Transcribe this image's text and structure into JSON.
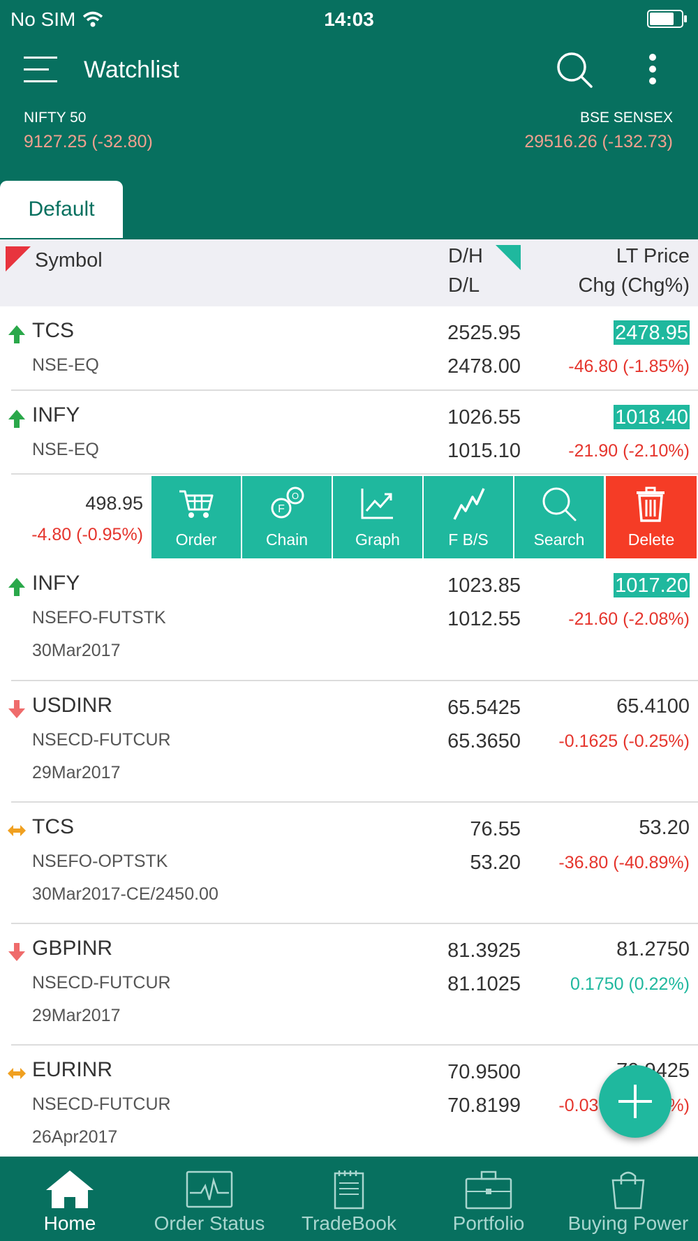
{
  "status": {
    "carrier": "No SIM",
    "time": "14:03"
  },
  "appbar": {
    "title": "Watchlist"
  },
  "indices": {
    "left": {
      "name": "NIFTY 50",
      "value": "9127.25 (-32.80)"
    },
    "right": {
      "name": "BSE SENSEX",
      "value": "29516.26 (-132.73)"
    }
  },
  "tabs": {
    "active": "Default"
  },
  "columns": {
    "symbol": "Symbol",
    "dh": "D/H",
    "dl": "D/L",
    "lt": "LT Price",
    "chg": "Chg (Chg%)"
  },
  "rows": [
    {
      "symbol": "TCS",
      "exchange": "NSE-EQ",
      "expiry": "",
      "dh": "2525.95",
      "dl": "2478.00",
      "lt": "2478.95",
      "chg": "-46.80 (-1.85%)",
      "trend": "up"
    },
    {
      "symbol": "INFY",
      "exchange": "NSE-EQ",
      "expiry": "",
      "dh": "1026.55",
      "dl": "1015.10",
      "lt": "1018.40",
      "chg": "-21.90 (-2.10%)",
      "trend": "up"
    },
    {
      "symbol": "INFY",
      "exchange": "NSEFO-FUTSTK",
      "expiry": "30Mar2017",
      "dh": "1023.85",
      "dl": "1012.55",
      "lt": "1017.20",
      "chg": "-21.60 (-2.08%)",
      "trend": "up"
    },
    {
      "symbol": "USDINR",
      "exchange": "NSECD-FUTCUR",
      "expiry": "29Mar2017",
      "dh": "65.5425",
      "dl": "65.3650",
      "lt": "65.4100",
      "chg": "-0.1625 (-0.25%)",
      "trend": "down"
    },
    {
      "symbol": "TCS",
      "exchange": "NSEFO-OPTSTK",
      "expiry": "30Mar2017-CE/2450.00",
      "dh": "76.55",
      "dl": "53.20",
      "lt": "53.20",
      "chg": "-36.80 (-40.89%)",
      "trend": "flat"
    },
    {
      "symbol": "GBPINR",
      "exchange": "NSECD-FUTCUR",
      "expiry": "29Mar2017",
      "dh": "81.3925",
      "dl": "81.1025",
      "lt": "81.2750",
      "chg": "0.1750 (0.22%)",
      "trend": "down"
    },
    {
      "symbol": "EURINR",
      "exchange": "NSECD-FUTCUR",
      "expiry": "26Apr2017",
      "dh": "70.9500",
      "dl": "70.8199",
      "lt": "70.9425",
      "chg": "-0.0375 (-0.05%)",
      "trend": "flat"
    }
  ],
  "swiped_row": {
    "price": "498.95",
    "chg": "-4.80 (-0.95%)"
  },
  "actions": {
    "order": "Order",
    "chain": "Chain",
    "graph": "Graph",
    "fbs": "F B/S",
    "search": "Search",
    "delete": "Delete"
  },
  "bottom_nav": {
    "home": "Home",
    "order_status": "Order Status",
    "tradebook": "TradeBook",
    "portfolio": "Portfolio",
    "buying_power": "Buying Power"
  },
  "colors": {
    "brand": "#07705f",
    "accent": "#1fb89e",
    "negative": "#e5352d",
    "delete": "#f53c26"
  }
}
